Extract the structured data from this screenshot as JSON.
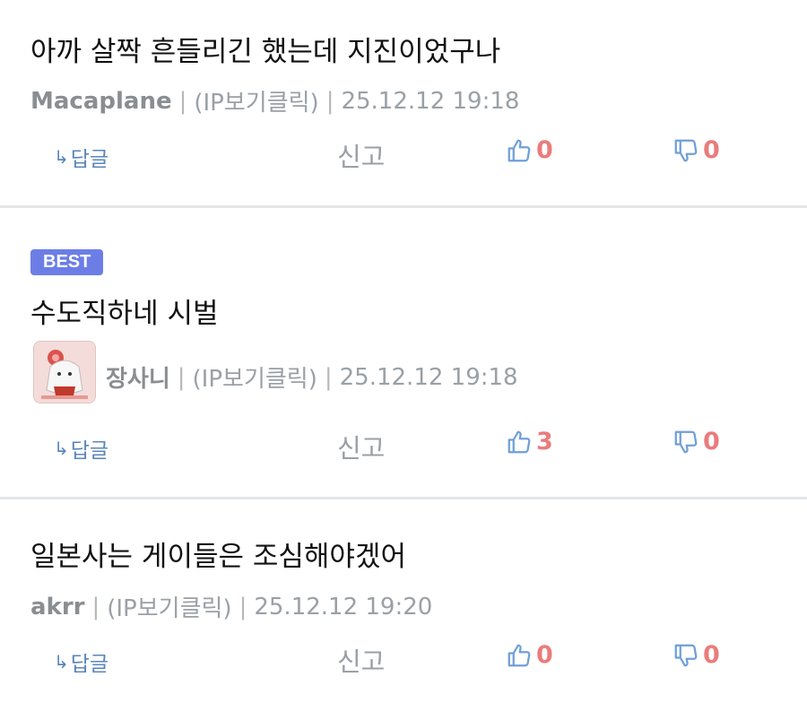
{
  "comments": [
    {
      "text": "아까 살짝 흔들리긴 했는데 지진이었구나",
      "nick": "Macaplane",
      "ip": "(IP보기클릭)",
      "time": "25.12.12 19:18",
      "reply": "답글",
      "report": "신고",
      "up": "0",
      "down": "0"
    },
    {
      "badge": "BEST",
      "text": "수도직하네 시벌",
      "nick": "장사니",
      "ip": "(IP보기클릭)",
      "time": "25.12.12 19:18",
      "reply": "답글",
      "report": "신고",
      "up": "3",
      "down": "0"
    },
    {
      "text": "일본사는 게이들은 조심해야겠어",
      "nick": "akrr",
      "ip": "(IP보기클릭)",
      "time": "25.12.12 19:20",
      "reply": "답글",
      "report": "신고",
      "up": "0",
      "down": "0"
    }
  ],
  "separator": "|",
  "colors": {
    "accent": "#6c7ee6",
    "vote_count": "#ea7c7c",
    "reply": "#5a86b8",
    "meta": "#9aa0a6",
    "divider": "#e4e6e8"
  },
  "icons": [
    "reply-arrow-icon",
    "thumbs-up-icon",
    "thumbs-down-icon"
  ]
}
